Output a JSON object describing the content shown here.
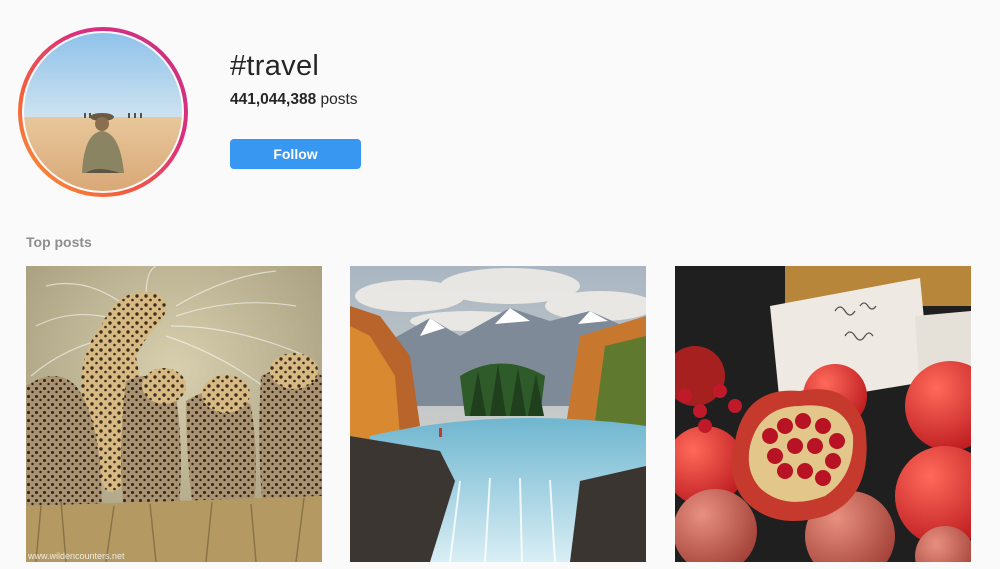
{
  "hashtag": {
    "title": "#travel",
    "post_count": "441,044,388",
    "post_count_suffix": " posts",
    "follow_label": "Follow"
  },
  "top_posts": {
    "label": "Top posts",
    "items": [
      {
        "subject": "cheetahs-photo",
        "watermark": "www.wildencounters.net"
      },
      {
        "subject": "mountain-waterfall-photo"
      },
      {
        "subject": "pomegranates-photo"
      }
    ]
  },
  "colors": {
    "follow_button": "#3897f0",
    "ring_gradient": [
      "#f9a13a",
      "#f5603b",
      "#dc2e7d",
      "#c13584"
    ],
    "background": "#fafafa",
    "section_label": "#8e8e8e"
  }
}
